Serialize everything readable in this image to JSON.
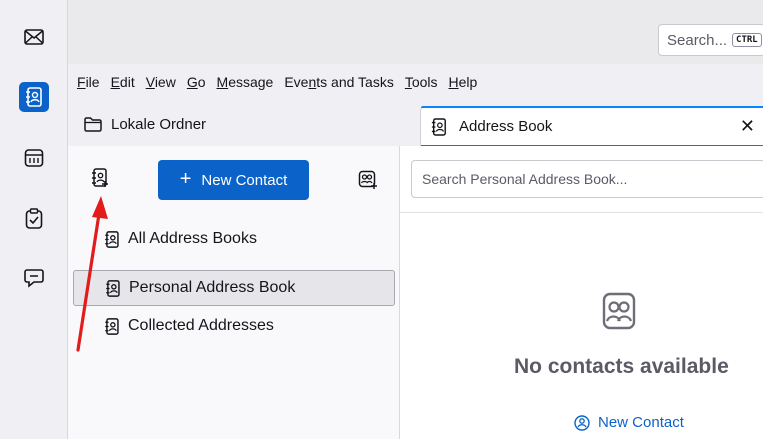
{
  "colors": {
    "accent": "#0b63c9",
    "annotation": "#e21b1b"
  },
  "spaces": [
    {
      "icon": "mail-icon",
      "active": false
    },
    {
      "icon": "address-book-icon",
      "active": true
    },
    {
      "icon": "calendar-icon",
      "active": false
    },
    {
      "icon": "tasks-icon",
      "active": false
    },
    {
      "icon": "chat-icon",
      "active": false
    }
  ],
  "titlebar": {
    "search_placeholder": "Search...",
    "search_shortcut": "CTRL"
  },
  "menu": [
    "File",
    "Edit",
    "View",
    "Go",
    "Message",
    "Events and Tasks",
    "Tools",
    "Help"
  ],
  "tabs": [
    {
      "label": "Lokale Ordner",
      "icon": "folder-icon",
      "active": false
    },
    {
      "label": "Address Book",
      "icon": "address-book-icon",
      "active": true,
      "close": "✕"
    }
  ],
  "sidebar": {
    "new_contact_label": "New Contact",
    "books": [
      {
        "label": "All Address Books",
        "selected": false
      },
      {
        "label": "Personal Address Book",
        "selected": true
      },
      {
        "label": "Collected Addresses",
        "selected": false
      }
    ]
  },
  "main": {
    "search_placeholder": "Search Personal Address Book...",
    "empty_text": "No contacts available",
    "new_contact_link": "New Contact"
  }
}
